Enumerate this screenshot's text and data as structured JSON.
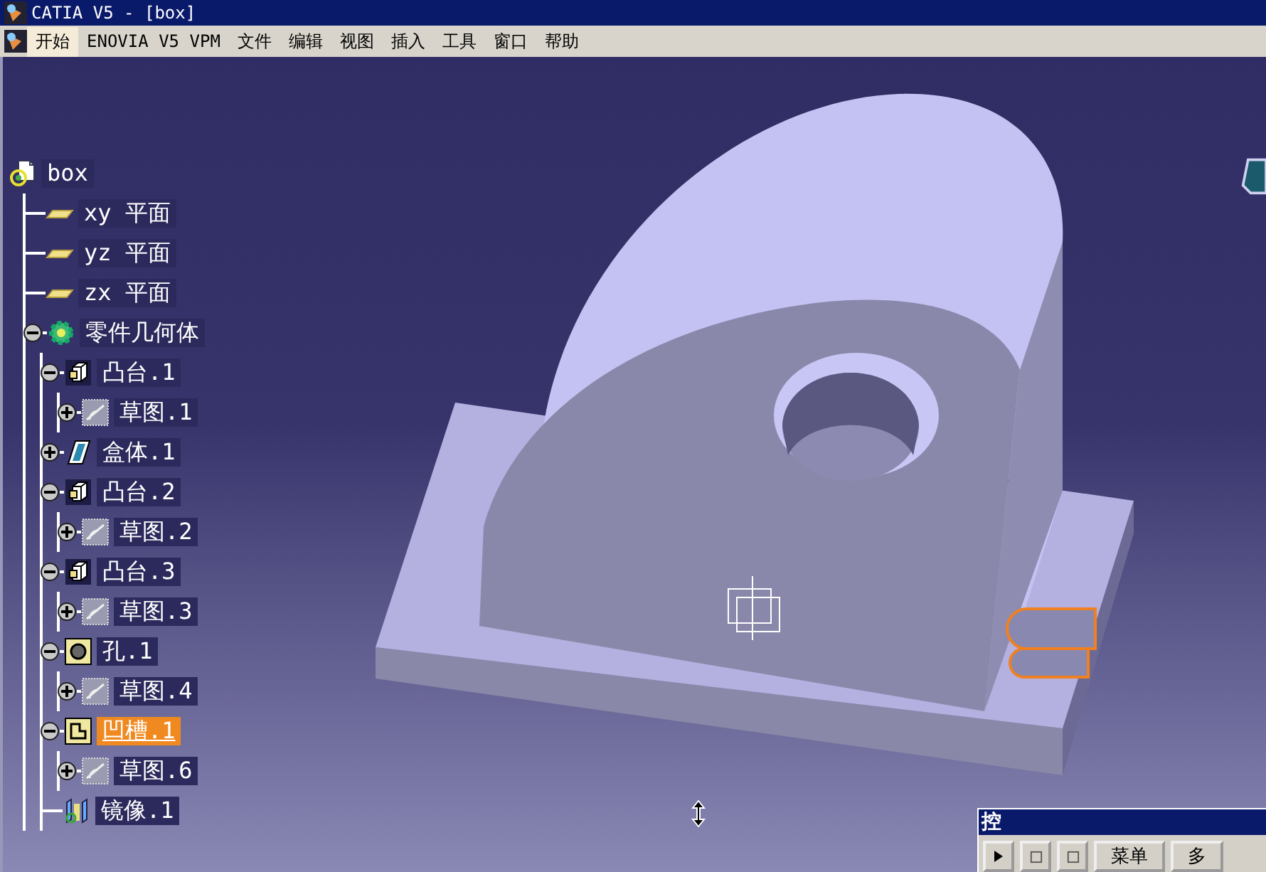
{
  "window": {
    "title": "CATIA V5 - [box]"
  },
  "menu_bar": [
    {
      "label": "开始",
      "selected": true
    },
    {
      "label": "ENOVIA V5 VPM",
      "selected": false
    },
    {
      "label": "文件",
      "selected": false
    },
    {
      "label": "编辑",
      "selected": false
    },
    {
      "label": "视图",
      "selected": false
    },
    {
      "label": "插入",
      "selected": false
    },
    {
      "label": "工具",
      "selected": false
    },
    {
      "label": "窗口",
      "selected": false
    },
    {
      "label": "帮助",
      "selected": false
    }
  ],
  "tree": {
    "label": "box",
    "kind": "part",
    "selected": false,
    "children": [
      {
        "label": "xy 平面",
        "kind": "plane",
        "selected": false
      },
      {
        "label": "yz 平面",
        "kind": "plane",
        "selected": false
      },
      {
        "label": "zx 平面",
        "kind": "plane",
        "selected": false
      },
      {
        "label": "零件几何体",
        "kind": "body",
        "selected": false,
        "expanded": true,
        "children": [
          {
            "label": "凸台.1",
            "kind": "pad",
            "selected": false,
            "expanded": true,
            "children": [
              {
                "label": "草图.1",
                "kind": "sketch",
                "selected": false,
                "expanded": false
              }
            ]
          },
          {
            "label": "盒体.1",
            "kind": "shell",
            "selected": false,
            "expanded": false
          },
          {
            "label": "凸台.2",
            "kind": "pad",
            "selected": false,
            "expanded": true,
            "children": [
              {
                "label": "草图.2",
                "kind": "sketch",
                "selected": false,
                "expanded": false
              }
            ]
          },
          {
            "label": "凸台.3",
            "kind": "pad",
            "selected": false,
            "expanded": true,
            "children": [
              {
                "label": "草图.3",
                "kind": "sketch",
                "selected": false,
                "expanded": false
              }
            ]
          },
          {
            "label": "孔.1",
            "kind": "hole",
            "selected": false,
            "expanded": true,
            "children": [
              {
                "label": "草图.4",
                "kind": "sketch",
                "selected": false,
                "expanded": false
              }
            ]
          },
          {
            "label": "凹槽.1",
            "kind": "pocket",
            "selected": true,
            "expanded": true,
            "children": [
              {
                "label": "草图.6",
                "kind": "sketch",
                "selected": false,
                "expanded": false
              }
            ]
          },
          {
            "label": "镜像.1",
            "kind": "mirror",
            "selected": false
          }
        ]
      }
    ]
  },
  "control_panel": {
    "title": "控",
    "buttons": [
      {
        "kind": "play"
      },
      {
        "kind": "icon"
      },
      {
        "kind": "icon"
      },
      {
        "kind": "text",
        "label": "菜单"
      },
      {
        "kind": "text",
        "label": "多"
      }
    ]
  }
}
